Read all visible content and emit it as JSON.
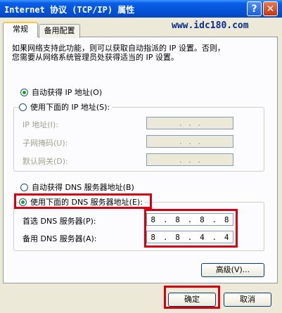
{
  "window": {
    "title": "Internet 协议 (TCP/IP) 属性",
    "help_glyph": "?",
    "close_glyph": "✕"
  },
  "watermark": "www.idc180.com",
  "tabs": [
    {
      "label": "常规",
      "active": true
    },
    {
      "label": "备用配置",
      "active": false
    }
  ],
  "description": {
    "line1": "如果网络支持此功能，则可以获取自动指派的 IP 设置。否则，",
    "line2": "您需要从网络系统管理员处获得适当的 IP 设置。"
  },
  "ip_section": {
    "auto_label": "自动获得 IP 地址(O)",
    "auto_selected": true,
    "manual_label": "使用下面的 IP 地址(S):",
    "manual_selected": false,
    "fields": [
      {
        "label": "IP 地址(I):",
        "value": ". . ."
      },
      {
        "label": "子网掩码(U):",
        "value": ". . ."
      },
      {
        "label": "默认网关(D):",
        "value": ". . ."
      }
    ]
  },
  "dns_section": {
    "auto_label": "自动获得 DNS 服务器地址(B)",
    "auto_selected": false,
    "manual_label": "使用下面的 DNS 服务器地址(E):",
    "manual_selected": true,
    "preferred_label": "首选 DNS 服务器(P):",
    "preferred_octets": [
      "8",
      "8",
      "8",
      "8"
    ],
    "alternate_label": "备用 DNS 服务器(A):",
    "alternate_octets": [
      "8",
      "8",
      "4",
      "4"
    ]
  },
  "buttons": {
    "advanced": "高级(V)...",
    "ok": "确定",
    "cancel": "取消"
  },
  "colors": {
    "titlebar": "#0453d8",
    "highlight": "#d40012",
    "radio_dot": "#21a121"
  }
}
